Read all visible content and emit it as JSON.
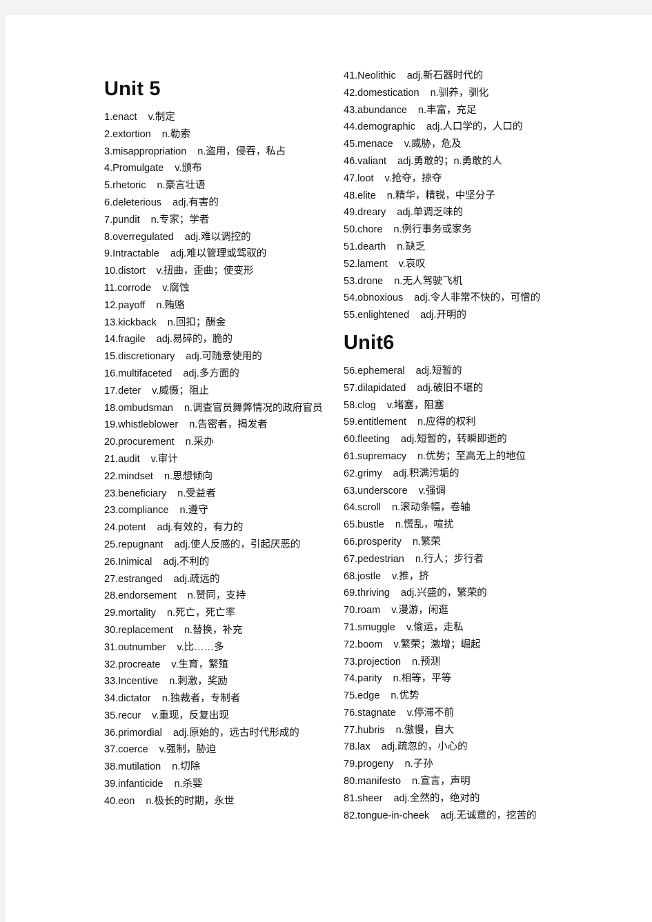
{
  "left_column": {
    "heading": "Unit  5",
    "entries": [
      {
        "term": "1.enact",
        "def": "v.制定"
      },
      {
        "term": "2.extortion",
        "def": "n.勒索"
      },
      {
        "term": "3.misappropriation",
        "def": "n.盗用，侵吞，私占"
      },
      {
        "term": "4.Promulgate",
        "def": "v.颁布"
      },
      {
        "term": "5.rhetoric",
        "def": "n.豪言壮语"
      },
      {
        "term": "6.deleterious",
        "def": "adj.有害的"
      },
      {
        "term": "7.pundit",
        "def": "n.专家；学者"
      },
      {
        "term": "8.overregulated",
        "def": "adj.难以调控的"
      },
      {
        "term": "9.Intractable",
        "def": "adj.难以管理或驾驭的"
      },
      {
        "term": "10.distort",
        "def": "v.扭曲，歪曲；使变形"
      },
      {
        "term": "11.corrode",
        "def": "v.腐蚀"
      },
      {
        "term": "12.payoff",
        "def": "n.贿赂"
      },
      {
        "term": "13.kickback",
        "def": "n.回扣；酬金"
      },
      {
        "term": "14.fragile",
        "def": "adj.易碎的，脆的"
      },
      {
        "term": "15.discretionary",
        "def": "adj.可随意使用的"
      },
      {
        "term": "16.multifaceted",
        "def": "adj.多方面的"
      },
      {
        "term": "17.deter",
        "def": "v.威慑；阻止"
      },
      {
        "term": "18.ombudsman",
        "def": "n.调查官员舞弊情况的政府官员"
      },
      {
        "term": "19.whistleblower",
        "def": "n.告密者，揭发者"
      },
      {
        "term": "20.procurement",
        "def": "n.采办"
      },
      {
        "term": "21.audit",
        "def": "v.审计"
      },
      {
        "term": "22.mindset",
        "def": "n.思想倾向"
      },
      {
        "term": "23.beneficiary",
        "def": "n.受益者"
      },
      {
        "term": "23.compliance",
        "def": "n.遵守"
      },
      {
        "term": "24.potent",
        "def": "adj.有效的，有力的"
      },
      {
        "term": "25.repugnant",
        "def": "adj.使人反感的，引起厌恶的"
      },
      {
        "term": "26.Inimical",
        "def": "adj.不利的"
      },
      {
        "term": "27.estranged",
        "def": "adj.疏远的"
      },
      {
        "term": "28.endorsement",
        "def": "n.赞同，支持"
      },
      {
        "term": "29.mortality",
        "def": "n.死亡，死亡率"
      },
      {
        "term": "30.replacement",
        "def": "n.替换，补充"
      },
      {
        "term": "31.outnumber",
        "def": "v.比……多"
      },
      {
        "term": "32.procreate",
        "def": "v.生育，繁殖"
      },
      {
        "term": "33.Incentive",
        "def": "n.刺激，奖励"
      },
      {
        "term": "34.dictator",
        "def": "n.独裁者，专制者"
      },
      {
        "term": "35.recur",
        "def": "v.重现，反复出现"
      },
      {
        "term": "36.primordial",
        "def": "adj.原始的，远古时代形成的"
      },
      {
        "term": "37.coerce",
        "def": "v.强制，胁迫"
      },
      {
        "term": "38.mutilation",
        "def": "n.切除"
      },
      {
        "term": "39.infanticide",
        "def": "n.杀婴"
      },
      {
        "term": "40.eon",
        "def": "n.极长的时期，永世"
      }
    ]
  },
  "right_column": {
    "entries_unit5": [
      {
        "term": "41.Neolithic",
        "def": "adj.新石器时代的"
      },
      {
        "term": "42.domestication",
        "def": "n.驯养，驯化"
      },
      {
        "term": "43.abundance",
        "def": "n.丰富，充足"
      },
      {
        "term": "44.demographic",
        "def": "adj.人口学的，人口的"
      },
      {
        "term": "45.menace",
        "def": "v.威胁，危及"
      },
      {
        "term": "46.valiant",
        "def": "adj.勇敢的；n.勇敢的人"
      },
      {
        "term": "47.loot",
        "def": "v.抢夺，掠夺"
      },
      {
        "term": "48.elite",
        "def": "n.精华，精锐，中坚分子"
      },
      {
        "term": "49.dreary",
        "def": "adj.单调乏味的"
      },
      {
        "term": "50.chore",
        "def": "n.例行事务或家务"
      },
      {
        "term": "51.dearth",
        "def": "n.缺乏"
      },
      {
        "term": "52.lament",
        "def": "v.哀叹"
      },
      {
        "term": "53.drone",
        "def": "n.无人驾驶飞机"
      },
      {
        "term": "54.obnoxious",
        "def": "adj.令人非常不快的，可憎的"
      },
      {
        "term": "55.enlightened",
        "def": "adj.开明的"
      }
    ],
    "heading_unit6": "Unit6",
    "entries_unit6": [
      {
        "term": "56.ephemeral",
        "def": "adj.短暂的"
      },
      {
        "term": "57.dilapidated",
        "def": "adj.破旧不堪的"
      },
      {
        "term": "58.clog",
        "def": "v.堵塞，阻塞"
      },
      {
        "term": "59.entitlement",
        "def": "n.应得的权利"
      },
      {
        "term": "60.fleeting",
        "def": "adj.短暂的，转瞬即逝的"
      },
      {
        "term": "61.supremacy",
        "def": "n.优势；至高无上的地位"
      },
      {
        "term": "62.grimy",
        "def": "adj.积满污垢的"
      },
      {
        "term": "63.underscore",
        "def": "v.强调"
      },
      {
        "term": "64.scroll",
        "def": "n.滚动条幅，卷轴"
      },
      {
        "term": "65.bustle",
        "def": "n.慌乱，喧扰"
      },
      {
        "term": "66.prosperity",
        "def": "n.繁荣"
      },
      {
        "term": "67.pedestrian",
        "def": "n.行人；步行者"
      },
      {
        "term": "68.jostle",
        "def": "v.推，挤"
      },
      {
        "term": "69.thriving",
        "def": "adj.兴盛的，繁荣的"
      },
      {
        "term": "70.roam",
        "def": "v.漫游，闲逛"
      },
      {
        "term": "71.smuggle",
        "def": "v.偷运，走私"
      },
      {
        "term": "72.boom",
        "def": "v.繁荣；激增；崛起"
      },
      {
        "term": "73.projection",
        "def": "n.预测"
      },
      {
        "term": "74.parity",
        "def": "n.相等，平等"
      },
      {
        "term": "75.edge",
        "def": "n.优势"
      },
      {
        "term": "76.stagnate",
        "def": "v.停滞不前"
      },
      {
        "term": "77.hubris",
        "def": "n.傲慢，自大"
      },
      {
        "term": "78.lax",
        "def": "adj.疏忽的，小心的"
      },
      {
        "term": "79.progeny",
        "def": "n.子孙"
      },
      {
        "term": "80.manifesto",
        "def": "n.宣言，声明"
      },
      {
        "term": "81.sheer",
        "def": "adj.全然的，绝对的"
      },
      {
        "term": "82.tongue-in-cheek",
        "def": "adj.无诚意的，挖苦的"
      }
    ]
  }
}
